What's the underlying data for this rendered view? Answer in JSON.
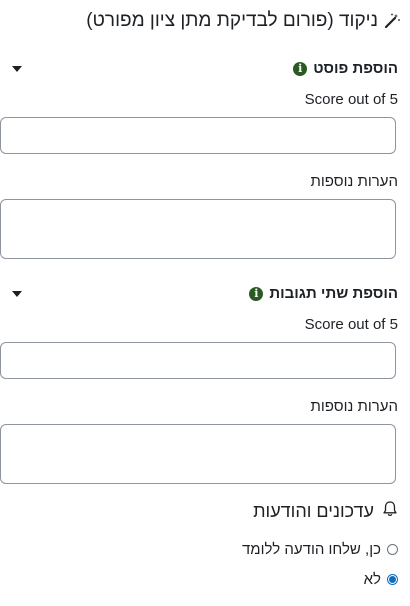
{
  "header": {
    "title": "ניקוד (פורום לבדיקת מתן ציון מפורט)",
    "icon": "magic-wand-icon"
  },
  "sections": [
    {
      "title": "הוספת פוסט",
      "score_label": "Score out of 5",
      "score_value": "",
      "remarks_label": "הערות נוספות",
      "remarks_value": ""
    },
    {
      "title": "הוספת שתי תגובות",
      "score_label": "Score out of 5",
      "score_value": "",
      "remarks_label": "הערות נוספות",
      "remarks_value": ""
    }
  ],
  "notifications": {
    "title": "עדכונים והודעות",
    "icon": "bell-icon",
    "options": [
      {
        "label": "כן, שלחו הודעה ללומד",
        "checked": false
      },
      {
        "label": "לא",
        "checked": true
      }
    ]
  },
  "colors": {
    "info_icon": "#2a5a22",
    "radio_checked": "#0f6cbf",
    "border": "#8f959e"
  }
}
